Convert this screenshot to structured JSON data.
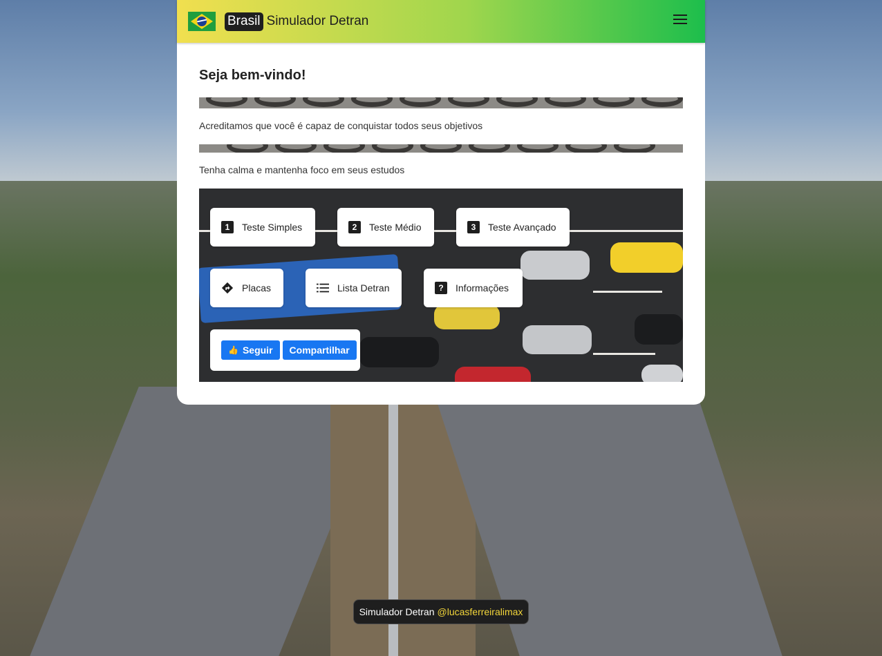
{
  "header": {
    "flag_icon": "brazil-flag-icon",
    "badge_text": "Brasil",
    "title": "Simulador Detran",
    "menu_icon": "hamburger-menu-icon",
    "gradient_colors": [
      "#f1df4f",
      "#9fd64d",
      "#1dbe4c"
    ]
  },
  "main": {
    "welcome": "Seja bem-vindo!",
    "line1": "Acreditamos que você é capaz de conquistar todos seus objetivos",
    "line2": "Tenha calma e mantenha foco em seus estudos"
  },
  "menu": {
    "test_simple": {
      "label": "Teste Simples",
      "icon_text": "1"
    },
    "test_medium": {
      "label": "Teste Médio",
      "icon_text": "2"
    },
    "test_advanced": {
      "label": "Teste Avançado",
      "icon_text": "3"
    },
    "signs": {
      "label": "Placas",
      "icon": "road-sign-icon"
    },
    "list": {
      "label": "Lista Detran",
      "icon": "list-icon"
    },
    "info": {
      "label": "Informações",
      "icon": "question-icon",
      "icon_text": "?"
    }
  },
  "social": {
    "follow": "Seguir",
    "share": "Compartilhar",
    "color": "#1877f2"
  },
  "footer": {
    "text": "Simulador Detran",
    "handle": "@lucasferreiralimax",
    "handle_color": "#f3d63a"
  }
}
